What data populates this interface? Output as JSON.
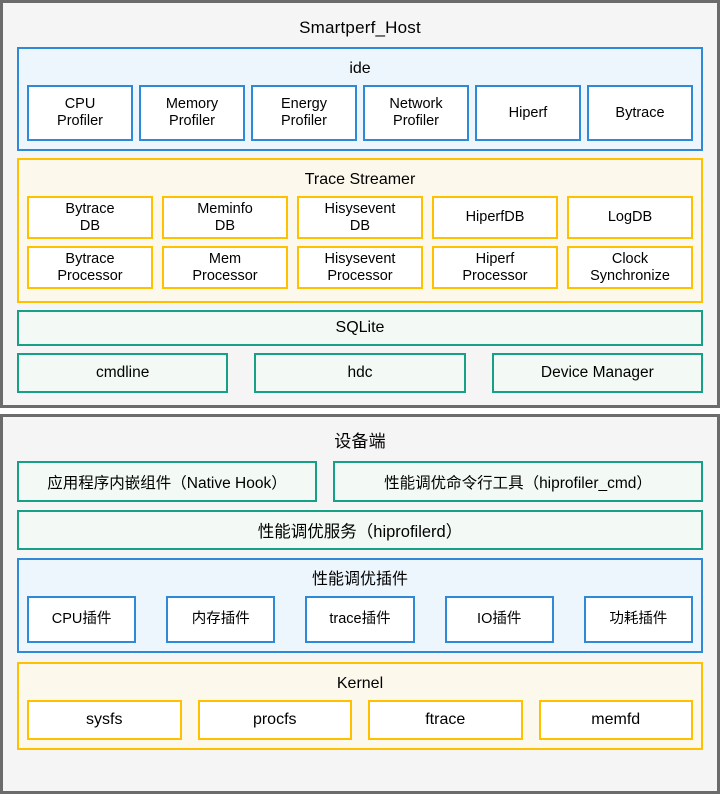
{
  "diagram": {
    "panels": [
      {
        "id": "smartperf-host",
        "title": "Smartperf_Host",
        "groups": {
          "ide": {
            "title": "ide",
            "color": "#2e8ad6",
            "items": [
              "CPU\nProfiler",
              "Memory\nProfiler",
              "Energy\nProfiler",
              "Network\nProfiler",
              "Hiperf",
              "Bytrace"
            ]
          },
          "trace_streamer": {
            "title": "Trace Streamer",
            "color": "#ffc000",
            "row1": [
              "Bytrace\nDB",
              "Meminfo\nDB",
              "Hisysevent\nDB",
              "HiperfDB",
              "LogDB"
            ],
            "row2": [
              "Bytrace\nProcessor",
              "Mem\nProcessor",
              "Hisysevent\nProcessor",
              "Hiperf\nProcessor",
              "Clock\nSynchronize"
            ]
          },
          "sqlite": {
            "label": "SQLite",
            "color": "#16a085"
          },
          "tools": {
            "color": "#16a085",
            "items": [
              "cmdline",
              "hdc",
              "Device Manager"
            ]
          }
        }
      },
      {
        "id": "device-side",
        "title": "设备端",
        "groups": {
          "top_tools": {
            "color": "#16a085",
            "items": [
              "应用程序内嵌组件（Native Hook）",
              "性能调优命令行工具（hiprofiler_cmd）"
            ]
          },
          "service": {
            "label": "性能调优服务（hiprofilerd）",
            "color": "#16a085"
          },
          "plugins": {
            "title": "性能调优插件",
            "color": "#2e8ad6",
            "items": [
              "CPU插件",
              "内存插件",
              "trace插件",
              "IO插件",
              "功耗插件"
            ]
          },
          "kernel": {
            "title": "Kernel",
            "color": "#ffc000",
            "items": [
              "sysfs",
              "procfs",
              "ftrace",
              "memfd"
            ]
          }
        }
      }
    ]
  }
}
